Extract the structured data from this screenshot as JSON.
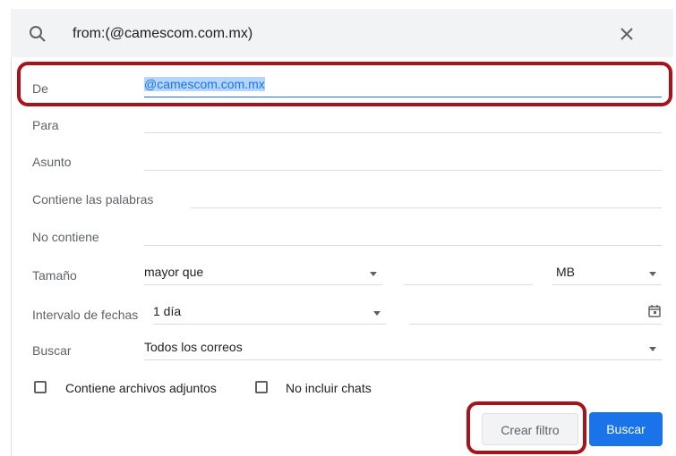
{
  "search": {
    "query": "from:(@camescom.com.mx)"
  },
  "form": {
    "from": {
      "label": "De",
      "value": "@camescom.com.mx"
    },
    "to": {
      "label": "Para",
      "value": ""
    },
    "subject": {
      "label": "Asunto",
      "value": ""
    },
    "has_words": {
      "label": "Contiene las palabras",
      "value": ""
    },
    "not_contains": {
      "label": "No contiene",
      "value": ""
    },
    "size": {
      "label": "Tamaño",
      "operator": "mayor que",
      "value": "",
      "unit": "MB"
    },
    "date_range": {
      "label": "Intervalo de fechas",
      "value": "1 día",
      "date": ""
    },
    "search_in": {
      "label": "Buscar",
      "value": "Todos los correos"
    },
    "has_attachment": {
      "label": "Contiene archivos adjuntos",
      "checked": false
    },
    "exclude_chats": {
      "label": "No incluir chats",
      "checked": false
    }
  },
  "buttons": {
    "create_filter": "Crear filtro",
    "search": "Buscar"
  },
  "colors": {
    "highlight": "#a8121a",
    "primary": "#1a73e8"
  },
  "icons": [
    "search-icon",
    "close-icon",
    "calendar-icon",
    "caret-down-icon"
  ]
}
